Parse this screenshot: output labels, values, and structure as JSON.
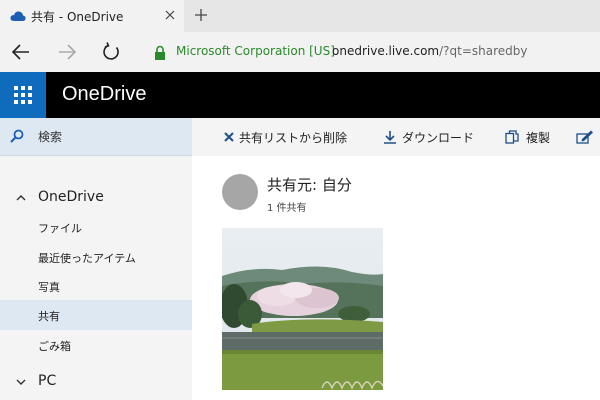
{
  "browser": {
    "tab_title": "共有 - OneDrive",
    "cert_name": "Microsoft Corporation [US]",
    "url_host": "onedrive.live.com",
    "url_path": "/?qt=sharedby"
  },
  "app": {
    "title": "OneDrive"
  },
  "sidebar": {
    "search_label": "検索",
    "sections": [
      {
        "label": "OneDrive",
        "expanded": true
      },
      {
        "label": "PC",
        "expanded": true
      }
    ],
    "items": [
      {
        "label": "ファイル"
      },
      {
        "label": "最近使ったアイテム"
      },
      {
        "label": "写真"
      },
      {
        "label": "共有",
        "selected": true
      },
      {
        "label": "ごみ箱"
      }
    ]
  },
  "commands": {
    "remove_label": "共有リストから削除",
    "download_label": "ダウンロード",
    "copy_label": "複製"
  },
  "main": {
    "owner_label": "共有元: 自分",
    "count_label": "1 件共有"
  },
  "colors": {
    "accent": "#0f6cbd",
    "selected_bg": "#dde8f3",
    "cert_green": "#2a8a2a"
  }
}
